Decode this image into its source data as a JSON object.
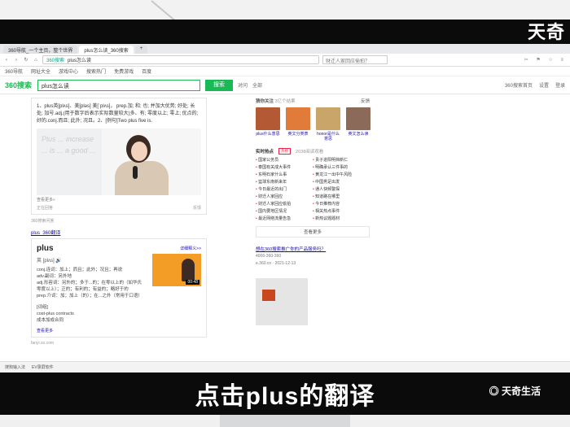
{
  "brand": "天奇",
  "browser": {
    "tabs": [
      "360导航_一个主页，整个世界",
      "plus怎么读_360搜索"
    ],
    "new_tab": "+",
    "url_host": "360搜索",
    "url_text": "plus怎么读",
    "address_search": "财迁人家回应偷拍？",
    "bookmarks": [
      "360导航",
      "网址大全",
      "游戏中心",
      "搜索热门",
      "免费游戏",
      "百度"
    ]
  },
  "search": {
    "logo": "360搜索",
    "query": "plus怎么读",
    "button": "搜索",
    "links": [
      "对问",
      "全部"
    ],
    "top_right": [
      "360搜索首页",
      "设置",
      "登录"
    ]
  },
  "result_main": {
    "definition": "1、plus英[plʌs]、美[pləs] 美[ˈplʌs]， prep.加; 和; 也; 并加大优势; 好处; 长处; 加号.adj.(用于数字后表示实际数量较大)多、有; 零度以上; 零上; 优点的; 好的.conj.而且; 此外; 况且。2、[例句]Two plus five is.",
    "board_text": "Plus ... increase ... is ... a good ...",
    "more_link": "查看更多»",
    "meta_left": "正在回答",
    "meta_right": "反馈",
    "source": "360搜索问答"
  },
  "dictionary": {
    "title": "plus_360翻译",
    "word": "plus",
    "detail_link": "详细释义>>",
    "phonetic": "英 [plʌs]",
    "glosses": [
      "conj.连词：加上；而且；此外；况且；再说",
      "adv.副词：另外地",
      "adj.形容词：另外的；多于...的；在零以上的（如华氏零度以上）；正的；有利的；有益的；略好于的",
      "prep.介词：加；加上（的）；在...之外（常用于口语）"
    ],
    "video_duration": "00:48",
    "phrases_head": "[词组]",
    "phrases": [
      "cost-plus contracts",
      "成本加成合同"
    ],
    "more": "查看更多",
    "source": "fanyi.so.com"
  },
  "sidebar": {
    "related_title": "猜你关注",
    "related_count": "3亿个结果",
    "feedback": "反馈",
    "thumbs": [
      {
        "caption": "plus什么意思",
        "color": "#b35a34"
      },
      {
        "caption": "英文分类表",
        "color": "#e07b3a"
      },
      {
        "caption": "honor是什么意思",
        "color": "#c9a56a"
      },
      {
        "caption": "英文怎么读",
        "color": "#8c6a5a"
      }
    ],
    "hot_title": "实时热点",
    "hot_tag": "热榜",
    "hot_sub": "2038阅读观看",
    "hot_items": [
      "国家公务员",
      "贵子进阳明挡新仁",
      "泰国有关成大事件",
      "明确承认三件事的",
      "东明石家什么事",
      "黄龙江一出中午风险",
      "篮球东南新来年",
      "中国男足出发",
      "今日最近的出门",
      "通人快频警探",
      "财迁人家回应",
      "知道路在哪里",
      "财迁人家回应偷拍",
      "今日推荐内容",
      "国内要地区情况",
      "相关热点事件",
      "最近网络流量告急",
      "新热议题题材"
    ],
    "see_more": "查看更多",
    "ad_title": "想在360搜索推广你的产品服务吗？",
    "ad_phone": "4006-360-360",
    "ad_url": "e.360.cn · 2021-12-13"
  },
  "taskbar": [
    "搜狗输入法",
    "EV录屏软件"
  ],
  "caption": "点击plus的翻译",
  "watermark": "天奇生活"
}
